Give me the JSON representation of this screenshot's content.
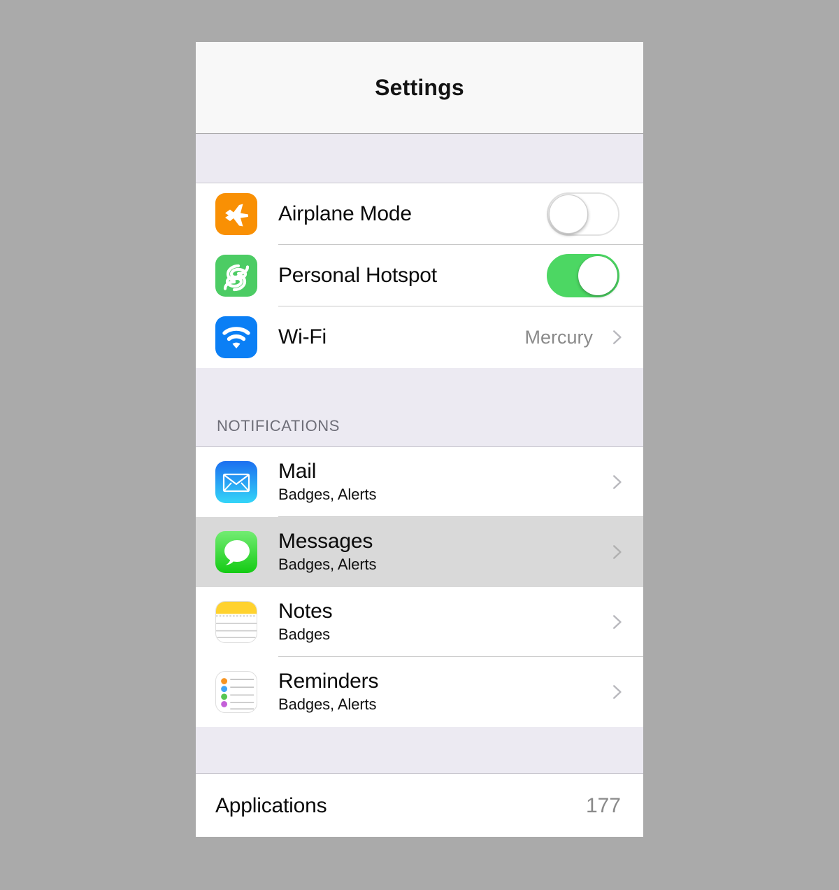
{
  "window": {
    "title": "Settings"
  },
  "sections": {
    "notifications_header": "NOTIFICATIONS"
  },
  "rows": {
    "airplane_mode": {
      "label": "Airplane Mode",
      "icon": "airplane-icon",
      "toggle_state": "off",
      "icon_color": "#f99004"
    },
    "personal_hotspot": {
      "label": "Personal Hotspot",
      "icon": "chain-link-icon",
      "toggle_state": "on",
      "icon_color": "#4ccc64",
      "toggle_on_color": "#4cd763"
    },
    "wifi": {
      "label": "Wi-Fi",
      "value": "Mercury",
      "icon": "wifi-icon",
      "icon_color": "#0b7ff5"
    },
    "mail": {
      "label": "Mail",
      "sub": "Badges, Alerts",
      "icon": "envelope-icon"
    },
    "messages": {
      "label": "Messages",
      "sub": "Badges, Alerts",
      "icon": "speech-bubble-icon",
      "selected": true,
      "selected_color": "#d9d9d9"
    },
    "notes": {
      "label": "Notes",
      "sub": "Badges",
      "icon": "notepad-icon",
      "icon_color": "#ffd22e"
    },
    "reminders": {
      "label": "Reminders",
      "sub": "Badges, Alerts",
      "icon": "checklist-icon"
    },
    "applications": {
      "label": "Applications",
      "value": "177"
    }
  }
}
